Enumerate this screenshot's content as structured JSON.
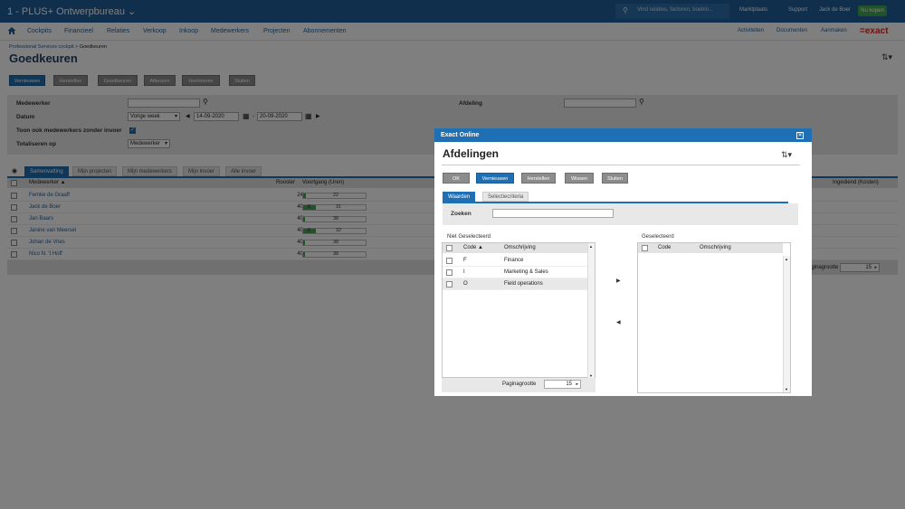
{
  "app": {
    "title": "1 - PLUS+ Ontwerpbureau",
    "search_placeholder": "Vind relaties, facturen, boekin...",
    "menu": [
      "Marktplaats",
      "Support",
      "Jack de Boer"
    ],
    "buy": "Nu kopen",
    "logo": "=exact"
  },
  "nav": {
    "items": [
      "Cockpits",
      "Financieel",
      "Relaties",
      "Verkoop",
      "Inkoop",
      "Medewerkers",
      "Projecten",
      "Abonnementen"
    ],
    "right": [
      "Activiteiten",
      "Documenten",
      "Aanmaken"
    ]
  },
  "page": {
    "breadcrumb_link": "Professional Services cockpit",
    "breadcrumb_sep": " > ",
    "breadcrumb_current": "Goedkeuren",
    "title": "Goedkeuren",
    "toolbar": [
      "Vernieuwen",
      "Herstellen",
      "Goedkeuren",
      "Afkeuren",
      "Herinneren",
      "Sluiten"
    ]
  },
  "filters": {
    "medewerker_label": "Medewerker",
    "afdeling_label": "Afdeling",
    "datum_label": "Datum",
    "period": "Vorige week",
    "date_from": "14-09-2020",
    "date_sep": "-",
    "date_to": "20-09-2020",
    "toon_label": "Toon ook medewerkers zonder invoer",
    "totaliseren_label": "Totaliseren op",
    "totaliseren_value": "Medewerker"
  },
  "tabs": [
    "Samenvatting",
    "Mijn projecten",
    "Mijn medewerkers",
    "Mijn invoer",
    "Alle invoer"
  ],
  "grid": {
    "headers": {
      "medewerker": "Medewerker ▲",
      "rooster": "Rooster",
      "voortgang": "Voortgang (Uren)",
      "ingediend": "Ingediend (Kosten)"
    },
    "rows": [
      {
        "name": "Femke de Graaff",
        "rooster": "24",
        "done": 2,
        "val": "22"
      },
      {
        "name": "Jack de Boer",
        "rooster": "40",
        "done": 8,
        "val": "31"
      },
      {
        "name": "Jan Baars",
        "rooster": "40",
        "done": 1,
        "val": "38"
      },
      {
        "name": "Janine van Meersel",
        "rooster": "40",
        "done": 8,
        "val": "32"
      },
      {
        "name": "Johan de Vries",
        "rooster": "40",
        "done": 1,
        "val": "38"
      },
      {
        "name": "Nico N. 't Hoff",
        "rooster": "40",
        "done": 1,
        "val": "38"
      }
    ],
    "footer": {
      "label": "Paginagrootte",
      "value": "15"
    }
  },
  "dialog": {
    "header": "Exact Online",
    "title": "Afdelingen",
    "buttons": [
      "OK",
      "Vernieuwen",
      "Herstellen",
      "Wissen",
      "Sluiten"
    ],
    "tabs": [
      "Waarden",
      "Selectiecriteria"
    ],
    "search_label": "Zoeken",
    "left_title": "Niet Geselecteerd",
    "right_title": "Geselecteerd",
    "col_code": "Code",
    "col_code_sorted": "Code ▲",
    "col_desc": "Omschrijving",
    "left_rows": [
      {
        "code": "F",
        "desc": "Finance"
      },
      {
        "code": "I",
        "desc": "Marketing & Sales"
      },
      {
        "code": "O",
        "desc": "Field operations"
      }
    ],
    "page_label": "Paginagrootte",
    "page_value": "15"
  },
  "colors": {
    "brand": "#1f5f99",
    "accent": "#1f6fb5",
    "progress": "#41a652",
    "logo": "#e3231b"
  }
}
